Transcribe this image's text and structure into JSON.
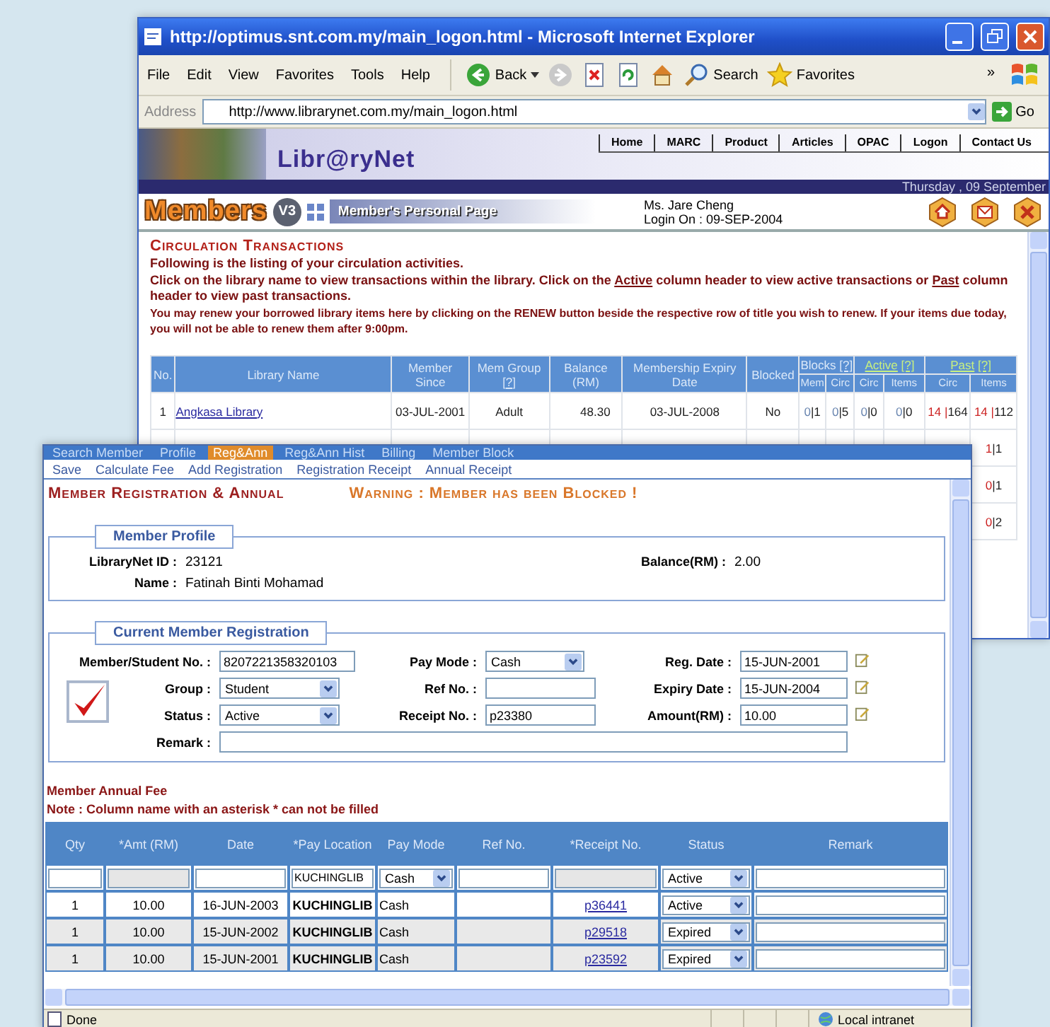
{
  "ie_window": {
    "title": "http://optimus.snt.com.my/main_logon.html - Microsoft Internet Explorer",
    "menu": [
      "File",
      "Edit",
      "View",
      "Favorites",
      "Tools",
      "Help"
    ],
    "toolbar": [
      {
        "kind": "back",
        "label": "Back"
      },
      {
        "kind": "forward"
      },
      {
        "kind": "stop"
      },
      {
        "kind": "refresh"
      },
      {
        "kind": "home"
      },
      {
        "kind": "search",
        "label": "Search"
      },
      {
        "kind": "favorites",
        "label": "Favorites"
      }
    ],
    "toolbar_overflow": "»",
    "address": {
      "label": "Address",
      "value": "http://www.librarynet.com.my/main_logon.html",
      "go": "Go"
    },
    "site": {
      "logo": "Libr@ryNet",
      "nav": [
        "Home",
        "MARC",
        "Product",
        "Articles",
        "OPAC",
        "Logon",
        "Contact Us"
      ],
      "date": "Thursday , 09 September",
      "brand": "Members",
      "version": "V3",
      "page_title": "Member's Personal Page",
      "user": "Ms. Jare Cheng",
      "login": "Login On : 09-SEP-2004"
    },
    "circulation": {
      "title": "Circulation Transactions",
      "intro": "Following is the listing of your circulation activities.",
      "instructions": [
        {
          "kind": "text",
          "text": "Click on the library name to view transactions within the library. Click on the"
        },
        {
          "kind": "link",
          "text": "Active"
        },
        {
          "kind": "text",
          "text": "column header to view active transactions or"
        },
        {
          "kind": "link",
          "text": "Past"
        },
        {
          "kind": "text",
          "text": "column header to view past transactions."
        }
      ],
      "renew_note": "You may renew your borrowed library items here by clicking on the RENEW button beside the respective row of title you wish to renew. If your items due today, you will not be able to renew them after 9:00pm."
    },
    "table": {
      "columns": [
        {
          "label": "No."
        },
        {
          "label": "Library Name"
        },
        {
          "label": "Member Since"
        },
        {
          "label": "Mem Group",
          "help": "[?]"
        },
        {
          "label": "Balance (RM)"
        },
        {
          "label": "Membership Expiry Date"
        },
        {
          "label": "Blocked"
        }
      ],
      "groups": [
        {
          "label": "Blocks",
          "help": "[?]",
          "link": false,
          "subcolumns": [
            "Mem",
            "Circ"
          ]
        },
        {
          "label": "Active",
          "help": "[?]",
          "link": true,
          "subcolumns": [
            "Circ",
            "Items"
          ]
        },
        {
          "label": "Past",
          "help": "[?]",
          "link": true,
          "subcolumns": [
            "Circ",
            "Items"
          ]
        }
      ],
      "rows": [
        {
          "no": "1",
          "library": "Angkasa Library",
          "since": "03-JUL-2001",
          "group": "Adult",
          "balance": "48.30",
          "expiry": "03-JUL-2008",
          "blocked": "No",
          "counts": [
            [
              "0",
              "|1"
            ],
            [
              "0",
              "|5"
            ],
            [
              "0",
              "|0"
            ],
            [
              "0",
              "|0"
            ],
            [
              "14 |",
              "164"
            ],
            [
              "14 |",
              "112"
            ]
          ]
        }
      ],
      "partial_rows": [
        {
          "last": [
            "1",
            "|1"
          ]
        },
        {
          "last": [
            "0",
            "|1"
          ]
        },
        {
          "last": [
            "0",
            "|2"
          ]
        }
      ]
    }
  },
  "registration_window": {
    "tabs": [
      {
        "label": "Search Member",
        "selected": false
      },
      {
        "label": "Profile",
        "selected": false
      },
      {
        "label": "Reg&Ann",
        "selected": true
      },
      {
        "label": "Reg&Ann Hist",
        "selected": false
      },
      {
        "label": "Billing",
        "selected": false
      },
      {
        "label": "Member Block",
        "selected": false
      }
    ],
    "actions": [
      "Save",
      "Calculate Fee",
      "Add Registration",
      "Registration Receipt",
      "Annual Receipt"
    ],
    "title": "Member Registration & Annual",
    "warning": "Warning : Member has been Blocked !",
    "profile": {
      "legend": "Member Profile",
      "id_label": "LibraryNet ID :",
      "id": "23121",
      "balance_label": "Balance(RM) :",
      "balance": "2.00",
      "name_label": "Name :",
      "name": "Fatinah Binti Mohamad"
    },
    "registration": {
      "legend": "Current Member Registration",
      "checked": true,
      "rows": [
        [
          {
            "label": "Member/Student No. :",
            "kind": "text",
            "value": "8207221358320103"
          },
          {
            "label": "Pay Mode :",
            "kind": "select",
            "value": "Cash"
          },
          {
            "label": "Reg. Date :",
            "kind": "date",
            "value": "15-JUN-2001"
          }
        ],
        [
          {
            "label": "Group :",
            "kind": "select",
            "value": "Student"
          },
          {
            "label": "Ref No. :",
            "kind": "text"
          },
          {
            "label": "Expiry Date :",
            "kind": "date",
            "value": "15-JUN-2004"
          }
        ],
        [
          {
            "label": "Status :",
            "kind": "select",
            "value": "Active"
          },
          {
            "label": "Receipt No. :",
            "kind": "text",
            "value": "p23380"
          },
          {
            "label": "Amount(RM) :",
            "kind": "date",
            "value": "10.00"
          }
        ]
      ],
      "remark_label": "Remark :"
    },
    "annual_fee": {
      "title": "Member Annual Fee",
      "note": "Note : Column name with an asterisk * can not be filled",
      "columns": [
        "Qty",
        "*Amt (RM)",
        "Date",
        "*Pay Location",
        "Pay Mode",
        "Ref No.",
        "*Receipt No.",
        "Status",
        "Remark"
      ],
      "entry_row": [
        {
          "kind": "input",
          "disabled": false
        },
        {
          "kind": "input",
          "disabled": true
        },
        {
          "kind": "input",
          "disabled": false
        },
        {
          "kind": "input",
          "disabled": false,
          "value": "KUCHINGLIB"
        },
        {
          "kind": "select",
          "value": "Cash"
        },
        {
          "kind": "input",
          "disabled": false
        },
        {
          "kind": "input",
          "disabled": true
        },
        {
          "kind": "select",
          "value": "Active"
        },
        {
          "kind": "input",
          "disabled": false
        }
      ],
      "rows": [
        {
          "shaded": false,
          "qty": "1",
          "amount": "10.00",
          "date": "16-JUN-2003",
          "location": "KUCHINGLIB",
          "pay_mode": "Cash",
          "receipt": "p36441",
          "status": "Active"
        },
        {
          "shaded": true,
          "qty": "1",
          "amount": "10.00",
          "date": "15-JUN-2002",
          "location": "KUCHINGLIB",
          "pay_mode": "Cash",
          "receipt": "p29518",
          "status": "Expired"
        },
        {
          "shaded": true,
          "qty": "1",
          "amount": "10.00",
          "date": "15-JUN-2001",
          "location": "KUCHINGLIB",
          "pay_mode": "Cash",
          "receipt": "p23592",
          "status": "Expired"
        }
      ]
    },
    "status_bar": {
      "text": "Done",
      "zone": "Local intranet"
    }
  }
}
